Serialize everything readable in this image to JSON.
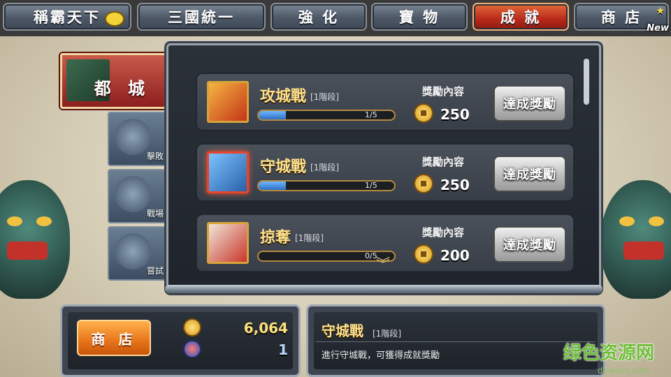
{
  "tabs": [
    {
      "label": "稱霸天下",
      "active": false
    },
    {
      "label": "三國統一",
      "active": false
    },
    {
      "label": "強 化",
      "active": false
    },
    {
      "label": "寶 物",
      "active": false
    },
    {
      "label": "成 就",
      "active": true
    },
    {
      "label": "商 店",
      "active": false,
      "badge": "New"
    }
  ],
  "categories": [
    {
      "label": "都 城",
      "selected": true
    },
    {
      "label": "擊敗",
      "selected": false
    },
    {
      "label": "戰場",
      "selected": false
    },
    {
      "label": "嘗試",
      "selected": false
    }
  ],
  "achievements": [
    {
      "title": "攻城戰",
      "stage": "[1階段]",
      "progress": "1/5",
      "progress_value": 0.2,
      "reward_label": "獎勵內容",
      "reward": "250",
      "button": "達成獎勵",
      "selected": false
    },
    {
      "title": "守城戰",
      "stage": "[1階段]",
      "progress": "1/5",
      "progress_value": 0.2,
      "reward_label": "獎勵內容",
      "reward": "250",
      "button": "達成獎勵",
      "selected": true
    },
    {
      "title": "掠奪",
      "stage": "[1階段]",
      "progress": "0/5",
      "progress_value": 0,
      "reward_label": "獎勵內容",
      "reward": "200",
      "button": "達成獎勵",
      "selected": false
    }
  ],
  "bottom": {
    "shop_button": "商 店",
    "coins": "6,064",
    "gems": "1"
  },
  "detail": {
    "title": "守城戰",
    "stage": "[1階段]",
    "description": "進行守城戰，可獲得成就獎勵"
  },
  "watermark": {
    "text": "绿色资源网",
    "url": "downcc.com"
  },
  "colors": {
    "active_tab": "#b8291a",
    "gold_text": "#ffe08a",
    "progress_fill": "#2e6fc2"
  }
}
